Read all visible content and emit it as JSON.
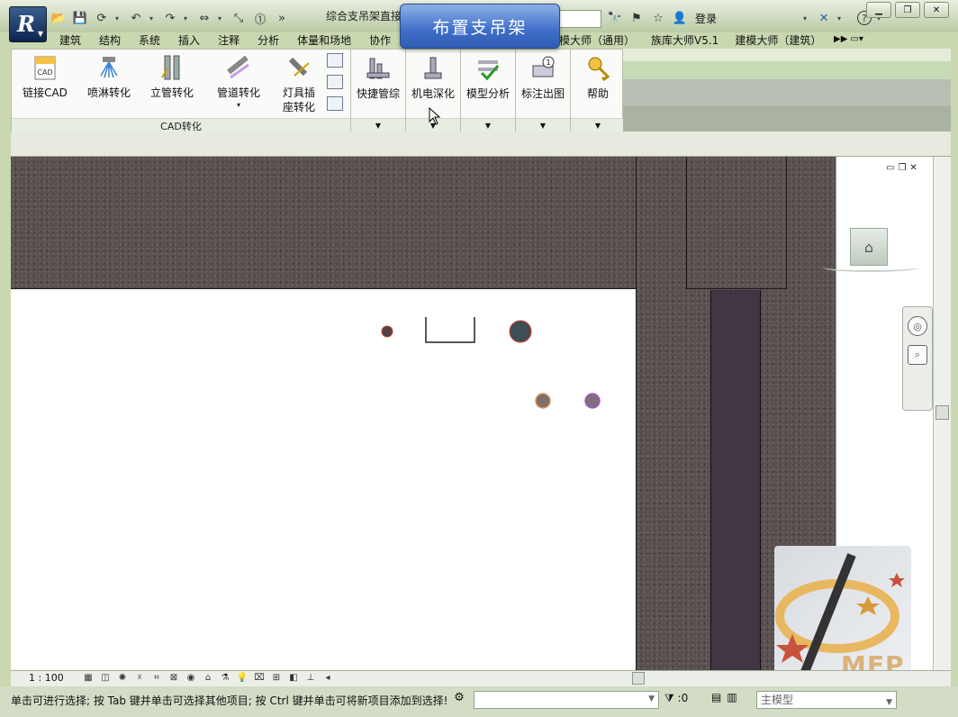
{
  "app": {
    "title": "综合支吊架直接",
    "search_value": "",
    "login_label": "登录"
  },
  "banner": {
    "text": "布置支吊架"
  },
  "ribbon_tabs": [
    "建筑",
    "结构",
    "系统",
    "插入",
    "注释",
    "分析",
    "体量和场地",
    "协作"
  ],
  "ribbon_tabs_right": [
    "模大师（通用）",
    "族库大师V5.1",
    "建模大师（建筑）"
  ],
  "cad_panel": {
    "label": "CAD转化",
    "buttons": [
      {
        "label": "链接CAD",
        "icon": "cad-link-icon"
      },
      {
        "label": "喷淋转化",
        "icon": "sprinkler-icon"
      },
      {
        "label": "立管转化",
        "icon": "riser-pipe-icon"
      },
      {
        "label": "管道转化",
        "icon": "pipe-convert-icon"
      },
      {
        "label": "灯具插座转化",
        "line1": "灯具插",
        "line2": "座转化",
        "icon": "lamp-socket-icon"
      }
    ]
  },
  "tool_panels": [
    {
      "label": "快捷管综",
      "icon": "quick-pipe-icon"
    },
    {
      "label": "机电深化",
      "icon": "mep-detail-icon"
    },
    {
      "label": "模型分析",
      "icon": "model-analysis-icon"
    },
    {
      "label": "标注出图",
      "icon": "annotate-print-icon"
    },
    {
      "label": "帮助",
      "icon": "help-key-icon"
    }
  ],
  "view": {
    "scale": "1 : 100"
  },
  "watermark": {
    "text": "MEP"
  },
  "status": {
    "message": "单击可进行选择; 按 Tab 键并单击可选择其他项目; 按 Ctrl 键并单击可将新项目添加到选择!",
    "selection_count": ":0",
    "model": "主模型"
  },
  "colors": {
    "accent": "#3f6fc8",
    "wall": "#5a5050",
    "duct": "#413644",
    "ribbon_bg": "#fafbf8"
  }
}
